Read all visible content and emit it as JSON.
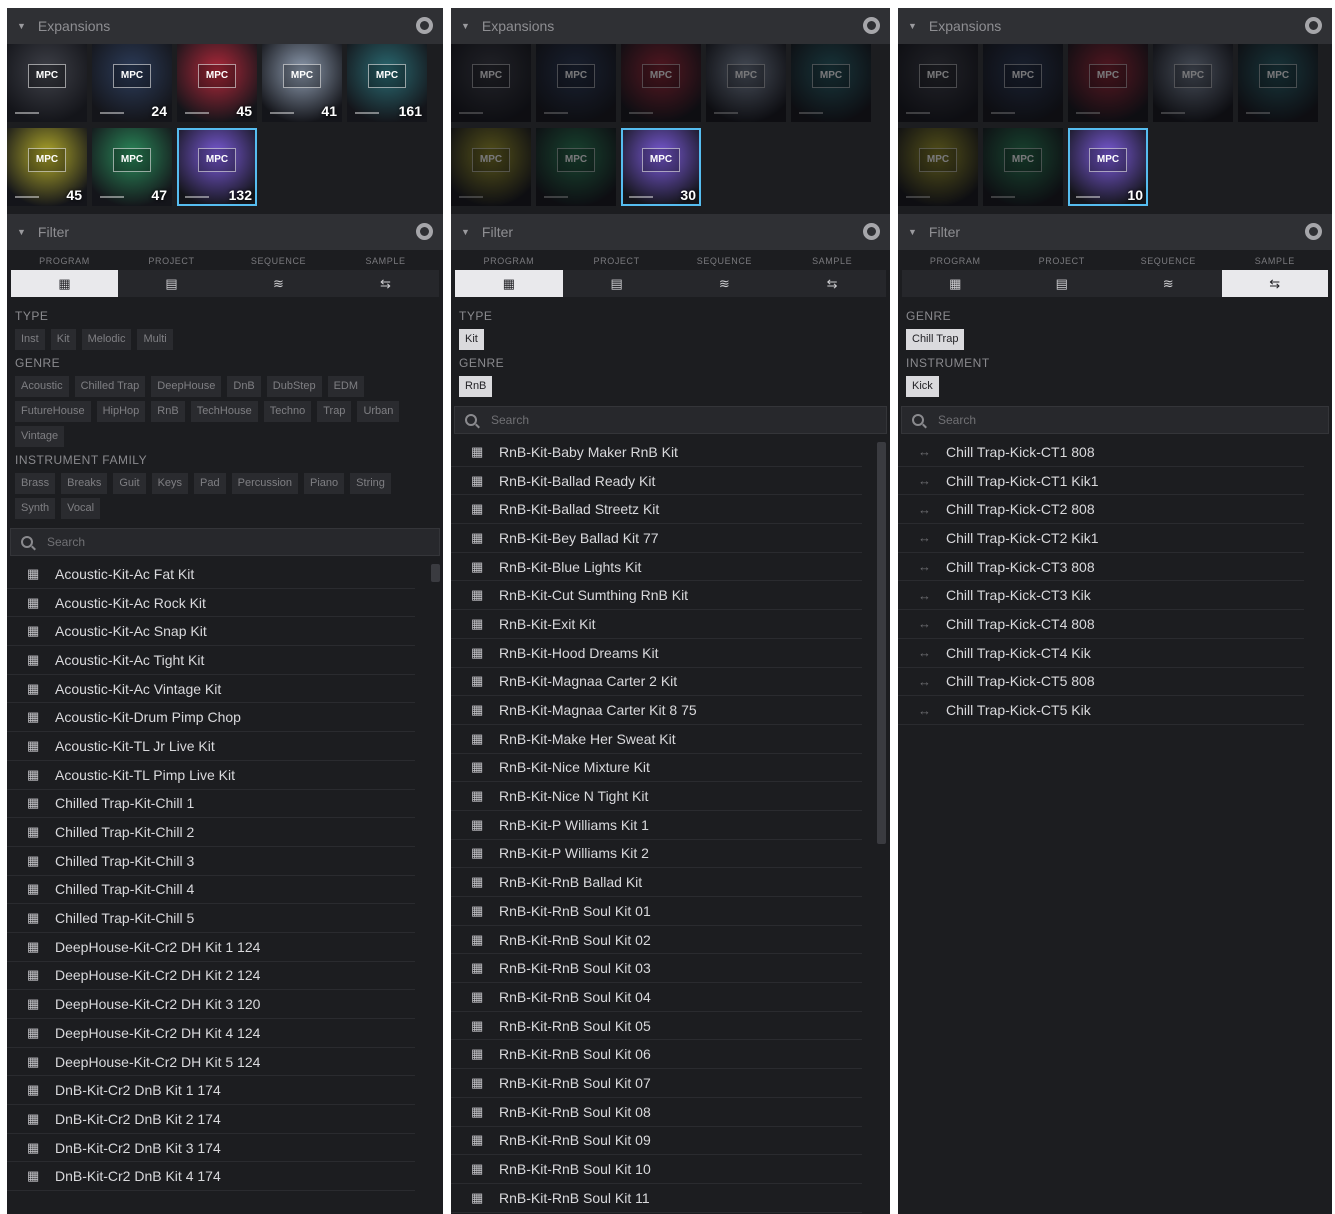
{
  "panels": [
    {
      "expansions_title": "Expansions",
      "filter_title": "Filter",
      "tiles": [
        {
          "count": "",
          "color": "#3e4048",
          "selected": false
        },
        {
          "count": "24",
          "color": "#2c3c5a",
          "selected": false
        },
        {
          "count": "45",
          "color": "#b0283a",
          "selected": false
        },
        {
          "count": "41",
          "color": "#8e9cb0",
          "selected": false
        },
        {
          "count": "161",
          "color": "#2a6a72",
          "selected": false
        },
        {
          "count": "45",
          "color": "#b0a82a",
          "selected": false
        },
        {
          "count": "47",
          "color": "#2a8a5a",
          "selected": false
        },
        {
          "count": "132",
          "color": "#7a5ad8",
          "selected": true
        }
      ],
      "content_tabs": [
        {
          "label": "PROGRAM",
          "icon": "▦",
          "active": true
        },
        {
          "label": "PROJECT",
          "icon": "▤",
          "active": false
        },
        {
          "label": "SEQUENCE",
          "icon": "≋",
          "active": false
        },
        {
          "label": "SAMPLE",
          "icon": "⇆",
          "active": false
        }
      ],
      "filters": [
        {
          "label": "TYPE",
          "chips": [
            "Inst",
            "Kit",
            "Melodic",
            "Multi"
          ],
          "on": []
        },
        {
          "label": "GENRE",
          "chips": [
            "Acoustic",
            "Chilled Trap",
            "DeepHouse",
            "DnB",
            "DubStep",
            "EDM",
            "FutureHouse",
            "HipHop",
            "RnB",
            "TechHouse",
            "Techno",
            "Trap",
            "Urban",
            "Vintage"
          ],
          "on": []
        },
        {
          "label": "INSTRUMENT FAMILY",
          "chips": [
            "Brass",
            "Breaks",
            "Guit",
            "Keys",
            "Pad",
            "Percussion",
            "Piano",
            "String",
            "Synth",
            "Vocal"
          ],
          "on": []
        }
      ],
      "search_placeholder": "Search",
      "row_icon": "grid",
      "rows": [
        "Acoustic-Kit-Ac Fat Kit",
        "Acoustic-Kit-Ac Rock Kit",
        "Acoustic-Kit-Ac Snap Kit",
        "Acoustic-Kit-Ac Tight Kit",
        "Acoustic-Kit-Ac Vintage Kit",
        "Acoustic-Kit-Drum Pimp Chop",
        "Acoustic-Kit-TL Jr Live Kit",
        "Acoustic-Kit-TL Pimp Live Kit",
        "Chilled Trap-Kit-Chill 1",
        "Chilled Trap-Kit-Chill 2",
        "Chilled Trap-Kit-Chill 3",
        "Chilled Trap-Kit-Chill 4",
        "Chilled Trap-Kit-Chill 5",
        "DeepHouse-Kit-Cr2 DH Kit 1 124",
        "DeepHouse-Kit-Cr2 DH Kit 2 124",
        "DeepHouse-Kit-Cr2 DH Kit 3 120",
        "DeepHouse-Kit-Cr2 DH Kit 4 124",
        "DeepHouse-Kit-Cr2 DH Kit 5 124",
        "DnB-Kit-Cr2 DnB Kit 1 174",
        "DnB-Kit-Cr2 DnB Kit 2 174",
        "DnB-Kit-Cr2 DnB Kit 3 174",
        "DnB-Kit-Cr2 DnB Kit 4 174"
      ]
    },
    {
      "expansions_title": "Expansions",
      "filter_title": "Filter",
      "tiles": [
        {
          "count": "",
          "color": "#3e4048",
          "selected": false
        },
        {
          "count": "",
          "color": "#2c3c5a",
          "selected": false
        },
        {
          "count": "",
          "color": "#b0283a",
          "selected": false
        },
        {
          "count": "",
          "color": "#8e9cb0",
          "selected": false
        },
        {
          "count": "",
          "color": "#2a6a72",
          "selected": false
        },
        {
          "count": "",
          "color": "#b0a82a",
          "selected": false
        },
        {
          "count": "",
          "color": "#2a8a5a",
          "selected": false
        },
        {
          "count": "30",
          "color": "#7a5ad8",
          "selected": true
        }
      ],
      "content_tabs": [
        {
          "label": "PROGRAM",
          "icon": "▦",
          "active": true
        },
        {
          "label": "PROJECT",
          "icon": "▤",
          "active": false
        },
        {
          "label": "SEQUENCE",
          "icon": "≋",
          "active": false
        },
        {
          "label": "SAMPLE",
          "icon": "⇆",
          "active": false
        }
      ],
      "filters": [
        {
          "label": "TYPE",
          "chips": [
            "Kit"
          ],
          "on": [
            "Kit"
          ]
        },
        {
          "label": "GENRE",
          "chips": [
            "RnB"
          ],
          "on": [
            "RnB"
          ]
        }
      ],
      "search_placeholder": "Search",
      "row_icon": "grid",
      "rows": [
        "RnB-Kit-Baby Maker RnB Kit",
        "RnB-Kit-Ballad Ready Kit",
        "RnB-Kit-Ballad Streetz Kit",
        "RnB-Kit-Bey Ballad Kit 77",
        "RnB-Kit-Blue Lights Kit",
        "RnB-Kit-Cut Sumthing RnB Kit",
        "RnB-Kit-Exit Kit",
        "RnB-Kit-Hood Dreams Kit",
        "RnB-Kit-Magnaa Carter 2 Kit",
        "RnB-Kit-Magnaa Carter Kit 8 75",
        "RnB-Kit-Make Her Sweat Kit",
        "RnB-Kit-Nice Mixture Kit",
        "RnB-Kit-Nice N Tight Kit",
        "RnB-Kit-P Williams Kit 1",
        "RnB-Kit-P Williams Kit 2",
        "RnB-Kit-RnB Ballad Kit",
        "RnB-Kit-RnB Soul Kit 01",
        "RnB-Kit-RnB Soul Kit 02",
        "RnB-Kit-RnB Soul Kit 03",
        "RnB-Kit-RnB Soul Kit 04",
        "RnB-Kit-RnB Soul Kit 05",
        "RnB-Kit-RnB Soul Kit 06",
        "RnB-Kit-RnB Soul Kit 07",
        "RnB-Kit-RnB Soul Kit 08",
        "RnB-Kit-RnB Soul Kit 09",
        "RnB-Kit-RnB Soul Kit 10",
        "RnB-Kit-RnB Soul Kit 11"
      ]
    },
    {
      "expansions_title": "Expansions",
      "filter_title": "Filter",
      "tiles": [
        {
          "count": "",
          "color": "#3e4048",
          "selected": false
        },
        {
          "count": "",
          "color": "#2c3c5a",
          "selected": false
        },
        {
          "count": "",
          "color": "#b0283a",
          "selected": false
        },
        {
          "count": "",
          "color": "#8e9cb0",
          "selected": false
        },
        {
          "count": "",
          "color": "#2a6a72",
          "selected": false
        },
        {
          "count": "",
          "color": "#b0a82a",
          "selected": false
        },
        {
          "count": "",
          "color": "#2a8a5a",
          "selected": false
        },
        {
          "count": "10",
          "color": "#7a5ad8",
          "selected": true
        }
      ],
      "content_tabs": [
        {
          "label": "PROGRAM",
          "icon": "▦",
          "active": false
        },
        {
          "label": "PROJECT",
          "icon": "▤",
          "active": false
        },
        {
          "label": "SEQUENCE",
          "icon": "≋",
          "active": false
        },
        {
          "label": "SAMPLE",
          "icon": "⇆",
          "active": true
        }
      ],
      "filters": [
        {
          "label": "GENRE",
          "chips": [
            "Chill Trap"
          ],
          "on": [
            "Chill Trap"
          ]
        },
        {
          "label": "INSTRUMENT",
          "chips": [
            "Kick"
          ],
          "on": [
            "Kick"
          ]
        }
      ],
      "search_placeholder": "Search",
      "row_icon": "wave",
      "rows": [
        "Chill Trap-Kick-CT1 808",
        "Chill Trap-Kick-CT1 Kik1",
        "Chill Trap-Kick-CT2 808",
        "Chill Trap-Kick-CT2 Kik1",
        "Chill Trap-Kick-CT3 808",
        "Chill Trap-Kick-CT3 Kik",
        "Chill Trap-Kick-CT4 808",
        "Chill Trap-Kick-CT4 Kik",
        "Chill Trap-Kick-CT5 808",
        "Chill Trap-Kick-CT5 Kik"
      ]
    }
  ],
  "colors": {
    "panel_bg": "#1c1d20",
    "header_bg": "#2f3034",
    "selection_outline": "#56bdf0",
    "active_tab_bg": "#e9e9ec"
  }
}
